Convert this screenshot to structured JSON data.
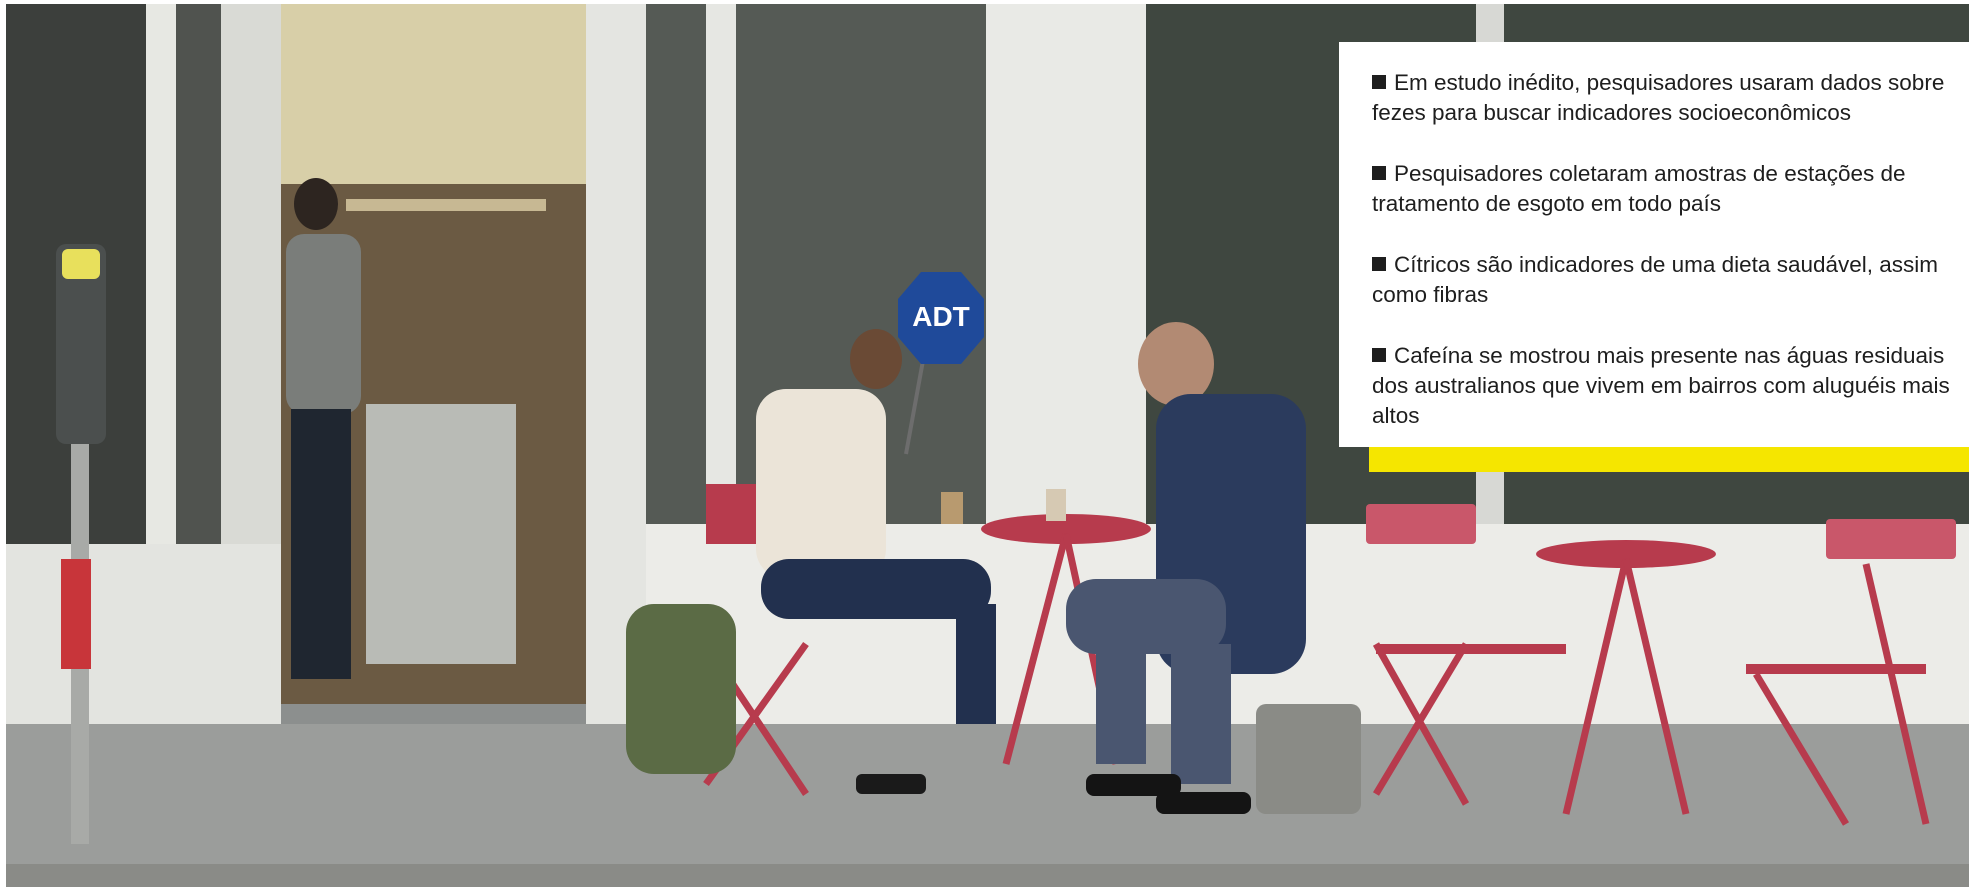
{
  "colors": {
    "accent": "#f5e600",
    "callout_background": "#ffffff",
    "text": "#1e1e1e"
  },
  "photo": {
    "sign_text": "ADT"
  },
  "callout": {
    "bullets": [
      "Em estudo inédito, pesquisadores usaram dados sobre fezes para buscar indicadores socioeconômicos",
      "Pesquisadores coletaram amostras de estações de tratamento de esgoto em todo país",
      "Cítricos são indicadores de uma dieta saudável, assim como fibras",
      "Cafeína se mostrou mais presente nas águas residuais dos australianos que vivem em bairros com aluguéis mais altos"
    ]
  }
}
